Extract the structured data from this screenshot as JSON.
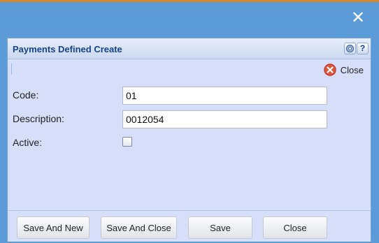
{
  "window": {
    "close_icon": "close-icon"
  },
  "panel": {
    "title": "Payments Defined Create",
    "header_icons": [
      "gear-icon",
      "help-icon"
    ],
    "help_glyph": "?"
  },
  "toolbar": {
    "close_label": "Close",
    "close_icon": "red-x-circle-icon"
  },
  "form": {
    "code_label": "Code:",
    "code_value": "01",
    "description_label": "Description:",
    "description_value": "0012054",
    "active_label": "Active:",
    "active_checked": false
  },
  "footer": {
    "save_and_new": "Save And New",
    "save_and_close": "Save And Close",
    "save": "Save",
    "close": "Close"
  },
  "colors": {
    "window_bg": "#5b9bd8",
    "panel_bg": "#d7defa",
    "title_color": "#15428b",
    "close_icon_red": "#e0533b"
  }
}
